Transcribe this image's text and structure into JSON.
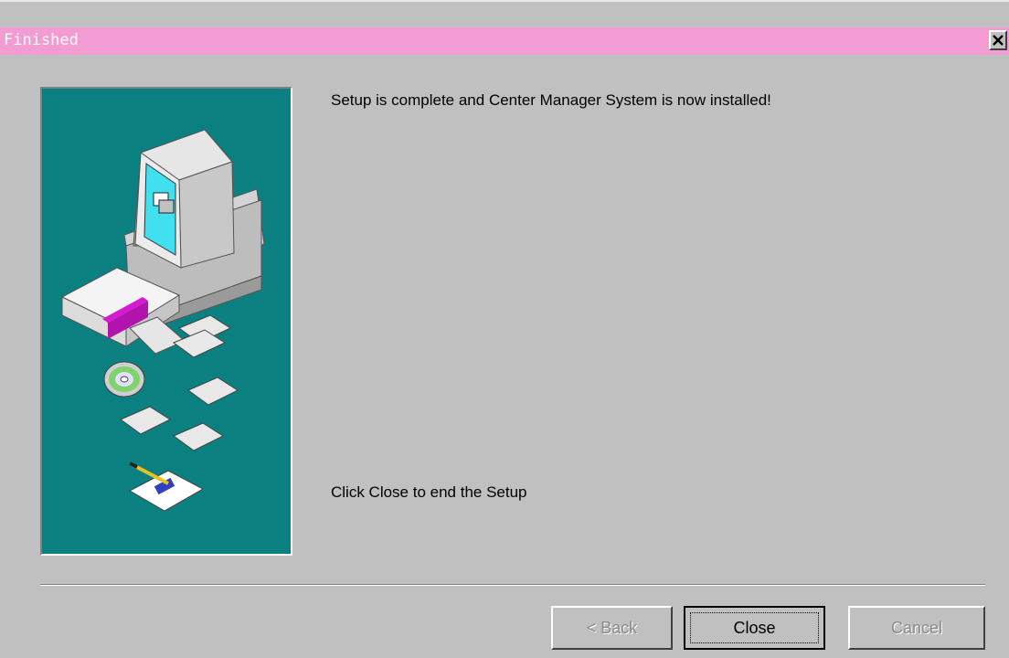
{
  "window": {
    "title": "Finished",
    "close_icon": "close-x-icon"
  },
  "content": {
    "message_top": "Setup is complete and Center Manager System is now installed!",
    "message_bottom": "Click Close to end the Setup"
  },
  "illustration": {
    "icons": [
      "computer-icon",
      "software-box-icon",
      "floppy-disk-icon",
      "cd-disc-icon",
      "pen-and-paper-icon"
    ],
    "background_color": "#0b8080"
  },
  "buttons": {
    "back": "< Back",
    "close": "Close",
    "cancel": "Cancel"
  },
  "colors": {
    "titlebar": "#f29cd3",
    "dialog": "#c0c0c0"
  }
}
